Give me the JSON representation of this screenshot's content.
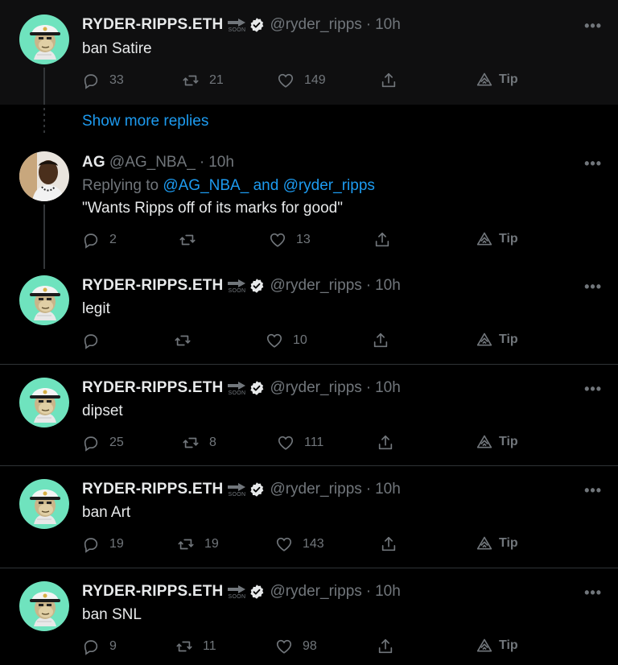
{
  "icons": {
    "reply": "speech-bubble-icon",
    "retweet": "retweet-icon",
    "like": "heart-icon",
    "share": "share-icon",
    "tip": "tip-icon",
    "more": "ellipsis-icon",
    "verified": "verified-badge-icon",
    "soon": "arrow-soon-icon"
  },
  "colors": {
    "background": "#000000",
    "link": "#1d9bf0",
    "muted": "#71767b",
    "text": "#e7e9ea",
    "ape_bg": "#6fe3be"
  },
  "show_more_replies": "Show more replies",
  "tweets": [
    {
      "name": "RYDER-RIPPS.ETH",
      "soon": "SOON",
      "handle": "@ryder_ripps",
      "dot": "·",
      "time": "10h",
      "more": "•••",
      "text": "ban Satire",
      "replies": "33",
      "retweets": "21",
      "likes": "149",
      "tip": "Tip"
    },
    {
      "name": "AG",
      "handle": "@AG_NBA_",
      "dot": "·",
      "time": "10h",
      "more": "•••",
      "replying_prefix": "Replying to",
      "replying_user1": "@AG_NBA_",
      "replying_and": "and",
      "replying_user2": "@ryder_ripps",
      "text": "\"Wants Ripps off of its marks for good\"",
      "replies": "2",
      "retweets": "",
      "likes": "13",
      "tip": "Tip"
    },
    {
      "name": "RYDER-RIPPS.ETH",
      "soon": "SOON",
      "handle": "@ryder_ripps",
      "dot": "·",
      "time": "10h",
      "more": "•••",
      "text": "legit",
      "replies": "",
      "retweets": "",
      "likes": "10",
      "tip": "Tip"
    },
    {
      "name": "RYDER-RIPPS.ETH",
      "soon": "SOON",
      "handle": "@ryder_ripps",
      "dot": "·",
      "time": "10h",
      "more": "•••",
      "text": "dipset",
      "replies": "25",
      "retweets": "8",
      "likes": "111",
      "tip": "Tip"
    },
    {
      "name": "RYDER-RIPPS.ETH",
      "soon": "SOON",
      "handle": "@ryder_ripps",
      "dot": "·",
      "time": "10h",
      "more": "•••",
      "text": "ban Art",
      "replies": "19",
      "retweets": "19",
      "likes": "143",
      "tip": "Tip"
    },
    {
      "name": "RYDER-RIPPS.ETH",
      "soon": "SOON",
      "handle": "@ryder_ripps",
      "dot": "·",
      "time": "10h",
      "more": "•••",
      "text": "ban SNL",
      "replies": "9",
      "retweets": "11",
      "likes": "98",
      "tip": "Tip"
    }
  ]
}
